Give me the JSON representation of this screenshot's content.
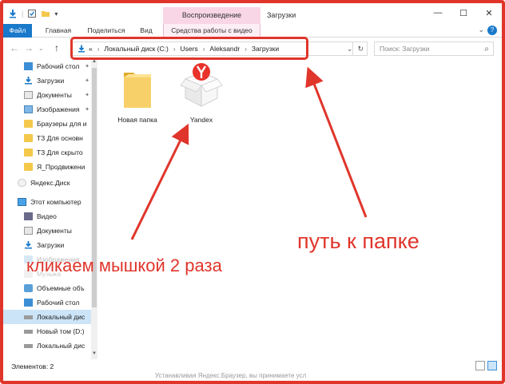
{
  "window": {
    "context_tab": "Воспроизведение",
    "title": "Загрузки",
    "controls": {
      "minimize": "—",
      "maximize": "☐",
      "close": "✕"
    }
  },
  "ribbon": {
    "tabs": [
      "Файл",
      "Главная",
      "Поделиться",
      "Вид"
    ],
    "context_tab": "Средства работы с видео"
  },
  "address": {
    "prefix": "«",
    "crumbs": [
      "Локальный диск (C:)",
      "Users",
      "Aleksandr",
      "Загрузки"
    ],
    "search_placeholder": "Поиск: Загрузки"
  },
  "sidebar": {
    "quick_access": [
      {
        "label": "Рабочий стол",
        "icon": "desktop-icon",
        "pinned": true
      },
      {
        "label": "Загрузки",
        "icon": "download-icon",
        "pinned": true
      },
      {
        "label": "Документы",
        "icon": "documents-icon",
        "pinned": true
      },
      {
        "label": "Изображения",
        "icon": "pictures-icon",
        "pinned": true
      },
      {
        "label": "Браузеры для и",
        "icon": "folder-icon",
        "pinned": false
      },
      {
        "label": "ТЗ Для основн",
        "icon": "folder-icon",
        "pinned": false
      },
      {
        "label": "ТЗ Для скрыто",
        "icon": "folder-icon",
        "pinned": false
      },
      {
        "label": "Я_Продвижени",
        "icon": "folder-icon",
        "pinned": false
      }
    ],
    "cloud": {
      "label": "Яндекс.Диск",
      "icon": "yandex-disk-icon"
    },
    "this_pc": {
      "label": "Этот компьютер",
      "icon": "computer-icon"
    },
    "pc_items": [
      {
        "label": "Видео",
        "icon": "video-icon"
      },
      {
        "label": "Документы",
        "icon": "documents-icon"
      },
      {
        "label": "Загрузки",
        "icon": "download-icon"
      },
      {
        "label": "Изображения",
        "icon": "pictures-icon"
      },
      {
        "label": "Музыка",
        "icon": "music-icon"
      },
      {
        "label": "Объемные объ",
        "icon": "3d-objects-icon"
      },
      {
        "label": "Рабочий стол",
        "icon": "desktop-icon"
      },
      {
        "label": "Локальный дис",
        "icon": "drive-icon",
        "selected": true
      },
      {
        "label": "Новый том (D:)",
        "icon": "drive-icon"
      },
      {
        "label": "Локальный дис",
        "icon": "drive-icon"
      }
    ]
  },
  "content": {
    "items": [
      {
        "label": "Новая папка",
        "icon": "folder-icon"
      },
      {
        "label": "Yandex",
        "icon": "yandex-package-icon"
      }
    ]
  },
  "status": {
    "count": "Элементов: 2"
  },
  "bottom_text": "Устанавливая Яндекс.Браузер, вы принимаете усл",
  "annotations": {
    "path": "путь к папке",
    "double_click": "кликаем мышкой 2 раза"
  },
  "colors": {
    "annotation": "#e0352b",
    "accent": "#1979ca",
    "folder": "#f4c84a",
    "context_tab": "#f9d6e6"
  }
}
